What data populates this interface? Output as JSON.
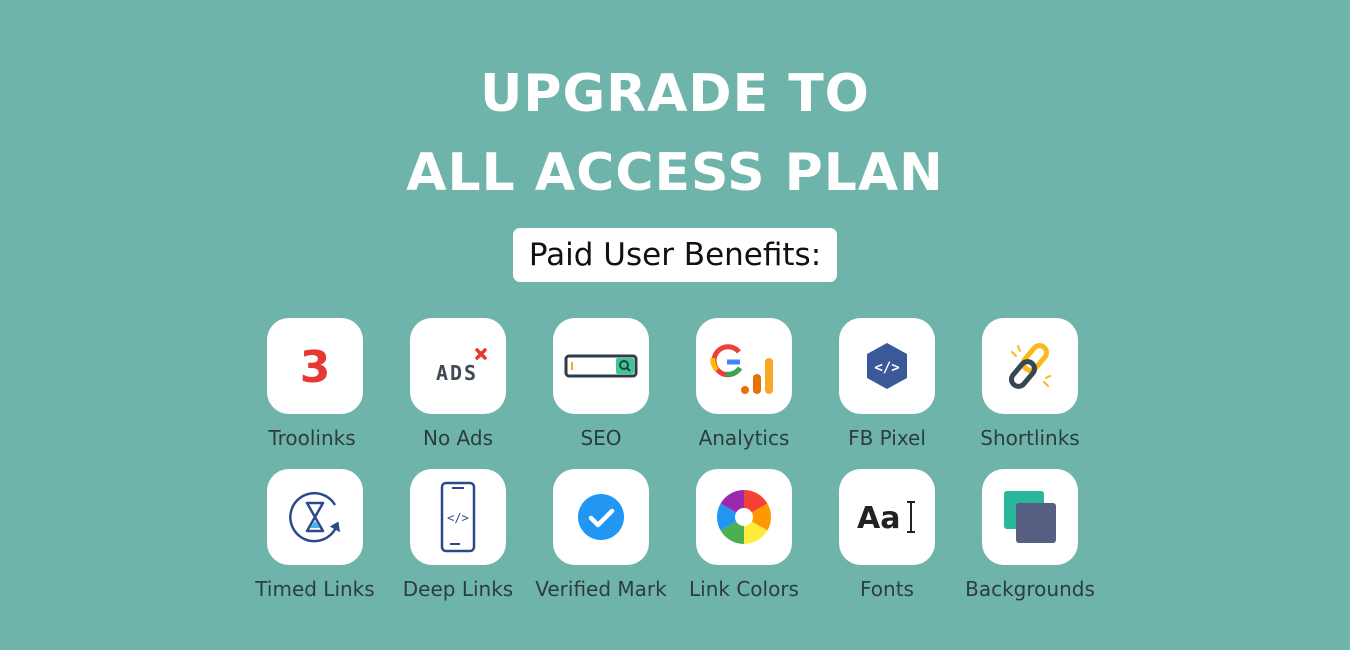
{
  "heading": {
    "line1": "UPGRADE TO",
    "line2": "ALL ACCESS PLAN"
  },
  "badge": "Paid User Benefits:",
  "benefits": [
    {
      "label": "Troolinks",
      "icon": "troolinks-3-icon",
      "glyph": "3"
    },
    {
      "label": "No Ads",
      "icon": "no-ads-icon",
      "glyph": "ADS"
    },
    {
      "label": "SEO",
      "icon": "search-bar-icon"
    },
    {
      "label": "Analytics",
      "icon": "google-analytics-icon",
      "glyph": "G"
    },
    {
      "label": "FB Pixel",
      "icon": "code-hexagon-icon",
      "glyph": "</>"
    },
    {
      "label": "Shortlinks",
      "icon": "chain-link-icon"
    },
    {
      "label": "Timed Links",
      "icon": "hourglass-timer-icon"
    },
    {
      "label": "Deep Links",
      "icon": "mobile-code-icon",
      "glyph": "</>"
    },
    {
      "label": "Verified Mark",
      "icon": "verified-check-icon"
    },
    {
      "label": "Link Colors",
      "icon": "color-wheel-icon"
    },
    {
      "label": "Fonts",
      "icon": "font-aa-icon",
      "glyph": "Aa"
    },
    {
      "label": "Backgrounds",
      "icon": "layered-squares-icon"
    }
  ],
  "colors": {
    "background": "#6fb4aa",
    "tile": "#ffffff",
    "label_text": "#2c3e3b",
    "troolinks_red": "#e53935",
    "ads_x_red": "#e53935",
    "seo_green": "#3cc98e",
    "analytics_orange": "#f9a825",
    "fb_pixel_blue": "#3b5998",
    "verified_blue": "#2196f3",
    "bg_square_teal": "#2ab69a",
    "bg_square_slate": "#565e82"
  }
}
